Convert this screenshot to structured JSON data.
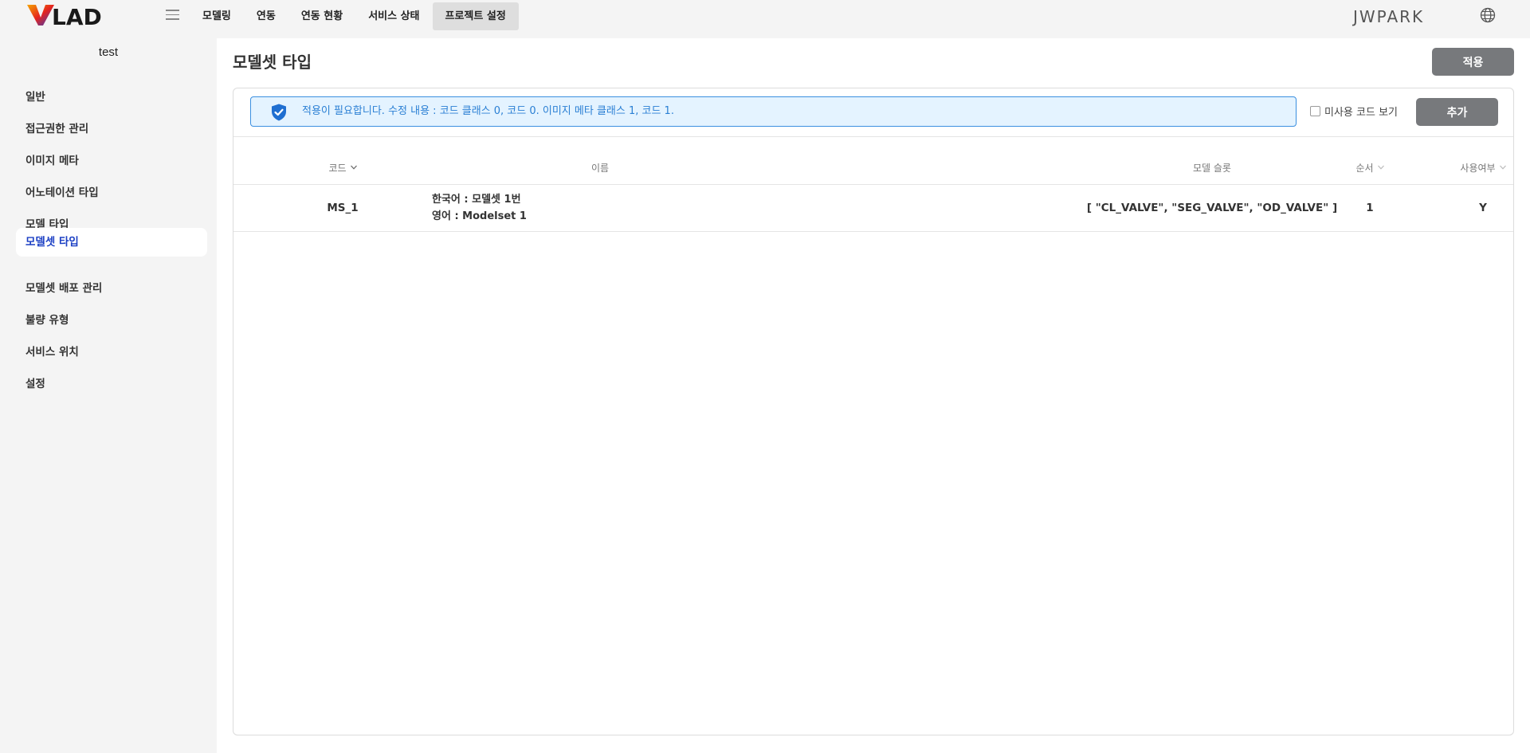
{
  "header": {
    "nav": [
      "모델링",
      "연동",
      "연동 현황",
      "서비스 상태",
      "프로젝트 설정"
    ],
    "active_nav": "프로젝트 설정",
    "username": "JWPARK",
    "icons": {
      "menu": "hamburger-icon",
      "language": "globe-icon"
    }
  },
  "sidebar": {
    "project_name": "test",
    "items": [
      {
        "label": "일반"
      },
      {
        "label": "접근권한 관리"
      },
      {
        "label": "이미지 메타"
      },
      {
        "label": "어노테이션 타입"
      },
      {
        "label": "모델 타입"
      },
      {
        "label": "모델셋 타입"
      },
      {
        "label": "모델셋 배포 관리"
      },
      {
        "label": "불량 유형"
      },
      {
        "label": "서비스 위치"
      },
      {
        "label": "설정"
      }
    ],
    "active": "모델셋 타입"
  },
  "main": {
    "title": "모델셋 타입",
    "apply_label": "적용",
    "notice": "적용이 필요합니다. 수정 내용 : 코드 클래스 0, 코드 0. 이미지 메타 클래스 1, 코드 1.",
    "unused_label": "미사용 코드 보기",
    "add_label": "추가",
    "table": {
      "headers": {
        "code": "코드",
        "name": "이름",
        "slot": "모델 슬롯",
        "order": "순서",
        "used": "사용여부"
      },
      "rows": [
        {
          "code": "MS_1",
          "name_ko": "한국어 : 모델셋 1번",
          "name_en": "영어 : Modelset 1",
          "slot": "[ \"CL_VALVE\", \"SEG_VALVE\", \"OD_VALVE\" ]",
          "order": "1",
          "used": "Y"
        }
      ]
    }
  }
}
